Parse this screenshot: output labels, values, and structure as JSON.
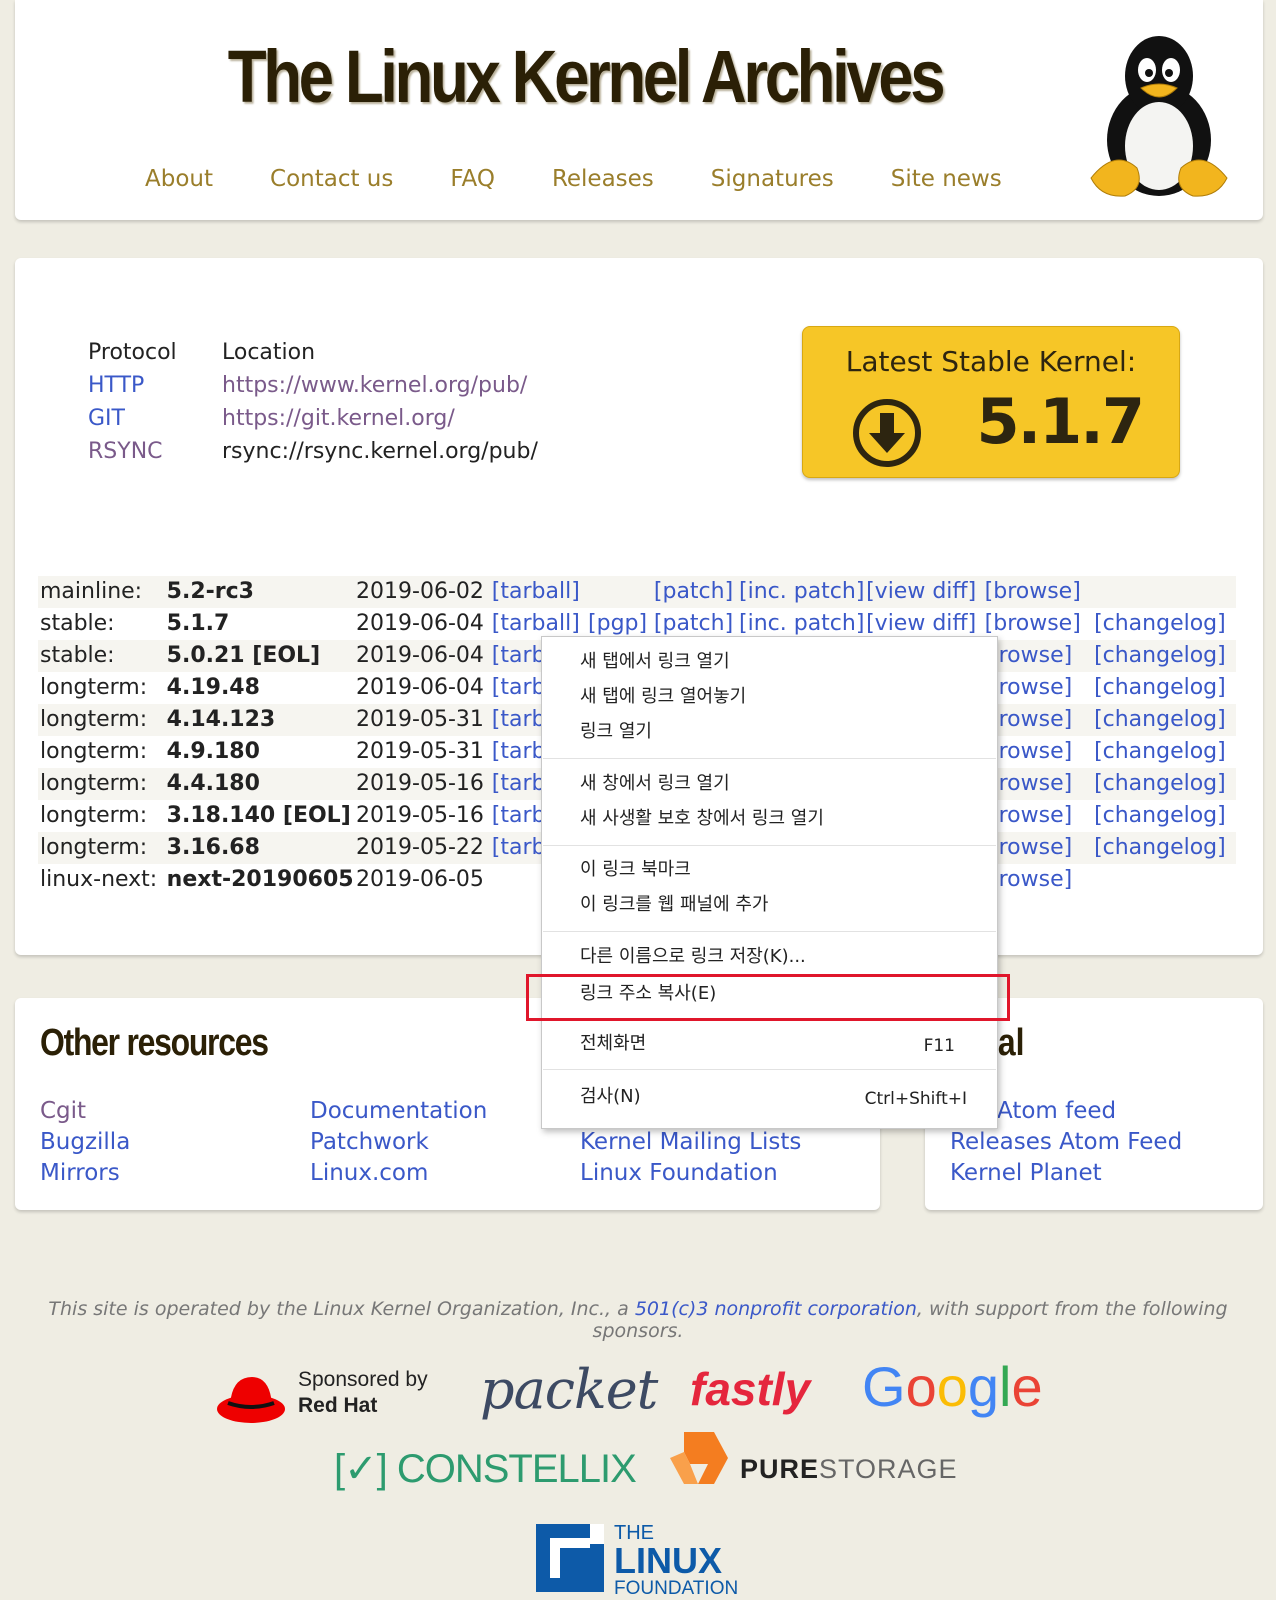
{
  "header": {
    "title": "The Linux Kernel Archives",
    "nav": [
      "About",
      "Contact us",
      "FAQ",
      "Releases",
      "Signatures",
      "Site news"
    ]
  },
  "protocols": {
    "head_protocol": "Protocol",
    "head_location": "Location",
    "rows": [
      {
        "protocol": "HTTP",
        "location": "https://www.kernel.org/pub/"
      },
      {
        "protocol": "GIT",
        "location": "https://git.kernel.org/"
      },
      {
        "protocol": "RSYNC",
        "location": "rsync://rsync.kernel.org/pub/"
      }
    ]
  },
  "stable_box": {
    "label": "Latest Stable Kernel:",
    "version": "5.1.7"
  },
  "releases": [
    {
      "kind": "mainline:",
      "version": "5.2-rc3",
      "date": "2019-06-02",
      "c1": "[tarball]",
      "c2": "",
      "c3": "[patch]",
      "c4": "[inc. patch]",
      "c5": "[view diff]",
      "c6": "[browse]",
      "c7": ""
    },
    {
      "kind": "stable:",
      "version": "5.1.7",
      "date": "2019-06-04",
      "c1": "[tarball]",
      "c2": "[pgp]",
      "c3": "[patch]",
      "c4": "[inc. patch]",
      "c5": "[view diff]",
      "c6": "[browse]",
      "c7": "[changelog]"
    },
    {
      "kind": "stable:",
      "version": "5.0.21 [EOL]",
      "date": "2019-06-04",
      "c1": "[tarba",
      "c2": "",
      "c3": "",
      "c4": "",
      "c5": "",
      "c6": "browse]",
      "c7": "[changelog]"
    },
    {
      "kind": "longterm:",
      "version": "4.19.48",
      "date": "2019-06-04",
      "c1": "[tarba",
      "c2": "",
      "c3": "",
      "c4": "",
      "c5": "",
      "c6": "browse]",
      "c7": "[changelog]"
    },
    {
      "kind": "longterm:",
      "version": "4.14.123",
      "date": "2019-05-31",
      "c1": "[tarba",
      "c2": "",
      "c3": "",
      "c4": "",
      "c5": "",
      "c6": "browse]",
      "c7": "[changelog]"
    },
    {
      "kind": "longterm:",
      "version": "4.9.180",
      "date": "2019-05-31",
      "c1": "[tarba",
      "c2": "",
      "c3": "",
      "c4": "",
      "c5": "",
      "c6": "browse]",
      "c7": "[changelog]"
    },
    {
      "kind": "longterm:",
      "version": "4.4.180",
      "date": "2019-05-16",
      "c1": "[tarba",
      "c2": "",
      "c3": "",
      "c4": "",
      "c5": "",
      "c6": "browse]",
      "c7": "[changelog]"
    },
    {
      "kind": "longterm:",
      "version": "3.18.140 [EOL]",
      "date": "2019-05-16",
      "c1": "[tarba",
      "c2": "",
      "c3": "",
      "c4": "",
      "c5": "",
      "c6": "browse]",
      "c7": "[changelog]"
    },
    {
      "kind": "longterm:",
      "version": "3.16.68",
      "date": "2019-05-22",
      "c1": "[tarba",
      "c2": "",
      "c3": "",
      "c4": "",
      "c5": "",
      "c6": "browse]",
      "c7": "[changelog]"
    },
    {
      "kind": "linux-next:",
      "version": "next-20190605",
      "date": "2019-06-05",
      "c1": "",
      "c2": "",
      "c3": "",
      "c4": "",
      "c5": "",
      "c6": "browse]",
      "c7": ""
    }
  ],
  "other": {
    "title": "Other resources",
    "col1": [
      "Cgit",
      "Bugzilla",
      "Mirrors"
    ],
    "col2": [
      "Documentation",
      "Patchwork",
      "Linux.com"
    ],
    "col3": [
      "Kernel Mailing Lists",
      "Linux Foundation"
    ]
  },
  "social": {
    "title_fragment": "ial",
    "links": [
      "Atom feed",
      "Releases Atom Feed",
      "Kernel Planet"
    ]
  },
  "footer": {
    "prefix": "This site is operated by the Linux Kernel Organization, Inc., a ",
    "link": "501(c)3 nonprofit corporation",
    "suffix": ", with support from the following sponsors."
  },
  "sponsors": {
    "redhat_line1": "Sponsored by",
    "redhat_line2": "Red Hat",
    "packet": "packet",
    "fastly": "fastly",
    "google": [
      "G",
      "o",
      "o",
      "g",
      "l",
      "e"
    ],
    "constellix": "[✓] CONSTELLIX",
    "pure_bold": "PURE",
    "pure_light": "STORAGE",
    "lf_line1": "THE",
    "lf_line2": "LINUX",
    "lf_line3": "FOUNDATION"
  },
  "context_menu": {
    "items": [
      "새 탭에서 링크 열기",
      "새 탭에 링크 열어놓기",
      "링크 열기",
      "새 창에서 링크 열기",
      "새 사생활 보호 창에서 링크 열기",
      "이 링크 북마크",
      "이 링크를 웹 패널에 추가",
      "다른 이름으로 링크 저장(K)...",
      "링크 주소 복사(E)",
      "전체화면",
      "검사(N)"
    ],
    "shortcut_fullscreen": "F11",
    "shortcut_inspect": "Ctrl+Shift+I"
  },
  "colors": {
    "link": "#3a58c8",
    "nav": "#9a7e2b",
    "stable_box": "#f6c627",
    "highlight": "#e0162b"
  }
}
